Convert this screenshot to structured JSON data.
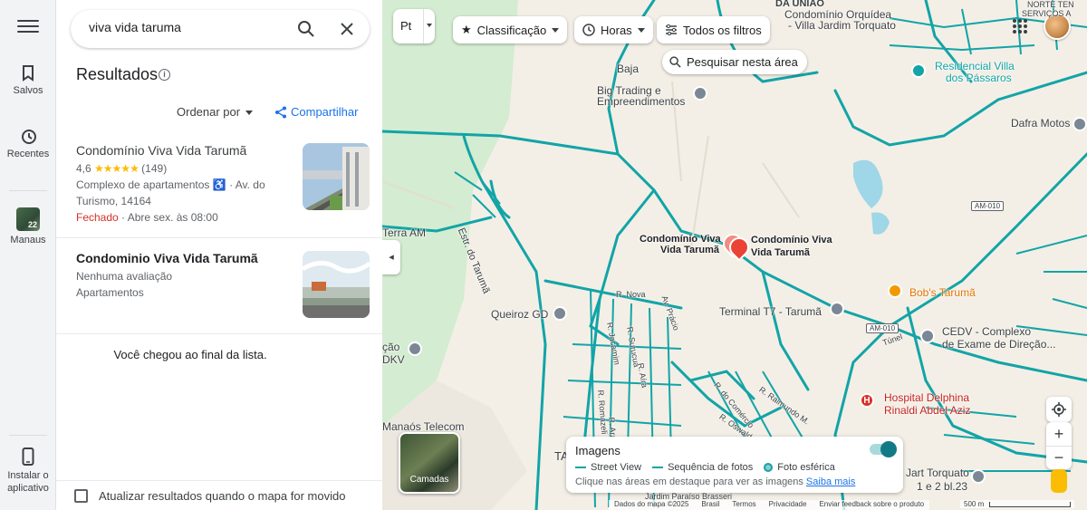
{
  "rail": {
    "items": [
      {
        "label": "Salvos",
        "icon": "bookmark-icon"
      },
      {
        "label": "Recentes",
        "icon": "history-icon"
      },
      {
        "label": "Manaus",
        "icon": "place-thumbnail",
        "badge": "22"
      },
      {
        "label_line1": "Instalar o",
        "label_line2": "aplicativo",
        "icon": "phone-icon"
      }
    ]
  },
  "search": {
    "value": "viva vida taruma"
  },
  "results": {
    "title": "Resultados",
    "sort_label": "Ordenar por",
    "share_label": "Compartilhar",
    "items": [
      {
        "name": "Condomínio Viva Vida Tarumã",
        "rating": "4,6",
        "stars": "★★★★★",
        "reviews": "(149)",
        "type": "Complexo de apartamentos",
        "accessible": "♿",
        "address_start": "· Av. do",
        "address_end": "Turismo, 14164",
        "status": "Fechado",
        "hours": "· Abre sex. às 08:00"
      },
      {
        "name": "Condominio Viva Vida Tarumã",
        "rating_text": "Nenhuma avaliação",
        "type": "Apartamentos"
      }
    ],
    "end_text": "Você chegou ao final da lista.",
    "update_checkbox": "Atualizar resultados quando o mapa for movido"
  },
  "map": {
    "chips": [
      "Classificação",
      "Horas",
      "Todos os filtros"
    ],
    "pt_label": "Pt",
    "search_area": "Pesquisar nesta área",
    "labels": {
      "da_uniao": "DA UNIÃO",
      "orquidea_1": "Condomínio Orquídea",
      "orquidea_2": "- Villa Jardim Torquato",
      "norte_1": "NORTE TEN",
      "norte_2": "SERVIÇOS A",
      "baja": "Baja",
      "big_1": "Big Trading e",
      "big_2": "Empreendimentos",
      "residencial_1": "Residencial Villa",
      "residencial_2": "dos Pássaros",
      "dafra": "Dafra Motos",
      "am010_a": "AM-010",
      "am010_b": "AM-010",
      "terra": "Terra AM",
      "estr": "Estr. do Tarumã",
      "cvv1_a": "Condomínio Viva",
      "cvv1_b": "Vida Tarumã",
      "cvv2_a": "Condomínio Viva",
      "cvv2_b": "Vida Tarumã",
      "bobs": "Bob's Tarumã",
      "queiroz": "Queiroz GD",
      "terminal": "Terminal T7 - Tarumã",
      "cedv_1": "CEDV - Complexo",
      "cedv_2": "de Exame de Direção...",
      "tunel": "Túnel",
      "cao": "ção",
      "dkv": "DKV",
      "hospital_1": "Hospital Delphina",
      "hospital_2": "Rinaldi Abdel Aziz",
      "manaos": "Manaós Telecom",
      "ta": "TA",
      "torquato": "Jart Torquato",
      "bl23": "1 e 2 bl.23",
      "r_nova": "R. Nova",
      "r_jacamin": "R. Jacamim",
      "r_surucua": "R. Surucuá",
      "r_aira": "R. Aíra",
      "r_pracio": "Av. Prácio",
      "r_romazeli": "R. Romazeli",
      "r_arac": "R. Arac",
      "r_comercio": "R. do Comércio",
      "r_oswald": "R. Oswald",
      "r_raimundo": "R. Raimundo M.",
      "paraiso": "Jardim Paraíso Brasseri"
    },
    "layers_label": "Camadas",
    "imagens": {
      "title": "Imagens",
      "legend": [
        "Street View",
        "Sequência de fotos",
        "Foto esférica"
      ],
      "hint": "Clique nas áreas em destaque para ver as imagens",
      "link": "Saiba mais"
    },
    "attribution": [
      "Dados do mapa ©2025",
      "Brasil",
      "Termos",
      "Privacidade",
      "Enviar feedback sobre o produto"
    ],
    "scale": "500 m",
    "colors": {
      "road": "#12a4a7",
      "land": "#f3efe6",
      "green": "#d4ecd1",
      "water": "#9fd6e8",
      "closed": "#d93025",
      "link": "#1a73e8"
    }
  }
}
